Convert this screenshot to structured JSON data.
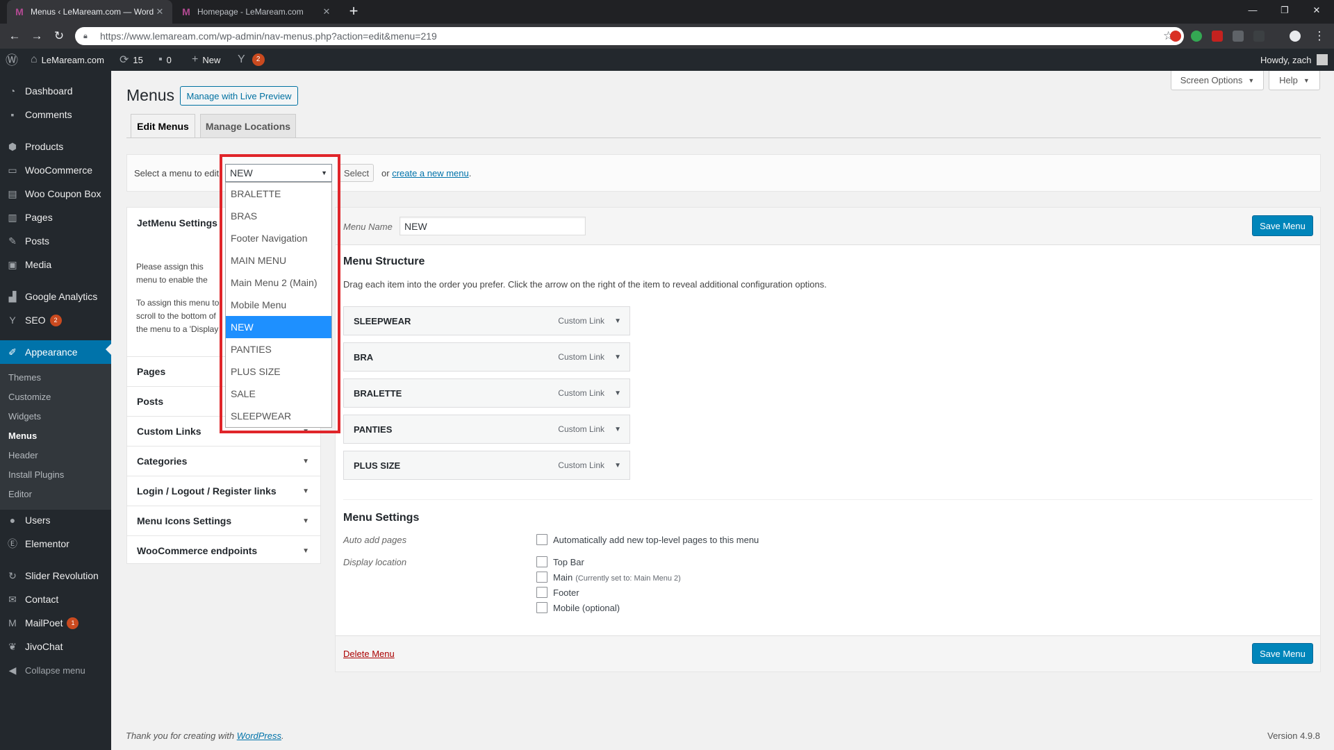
{
  "browser": {
    "tabs": [
      {
        "title": "Menus ‹ LeMaream.com — Word",
        "active": true
      },
      {
        "title": "Homepage - LeMaream.com",
        "active": false
      }
    ],
    "url": "https://www.lemaream.com/wp-admin/nav-menus.php?action=edit&menu=219"
  },
  "adminbar": {
    "site_name": "LeMaream.com",
    "updates": "15",
    "comments": "0",
    "new_label": "New",
    "seo_badge": "2",
    "howdy": "Howdy, zach"
  },
  "sidebar": {
    "items": [
      {
        "label": "Dashboard",
        "icon": "dashboard-icon"
      },
      {
        "label": "Comments",
        "icon": "comment-icon"
      },
      {
        "label": "Products",
        "icon": "products-icon"
      },
      {
        "label": "WooCommerce",
        "icon": "woocommerce-icon"
      },
      {
        "label": "Woo Coupon Box",
        "icon": "coupon-icon"
      },
      {
        "label": "Pages",
        "icon": "pages-icon"
      },
      {
        "label": "Posts",
        "icon": "pin-icon"
      },
      {
        "label": "Media",
        "icon": "media-icon"
      },
      {
        "label": "Google Analytics",
        "icon": "analytics-icon"
      },
      {
        "label": "SEO",
        "icon": "yoast-icon",
        "badge": "2"
      },
      {
        "label": "Appearance",
        "icon": "brush-icon",
        "active": true
      },
      {
        "label": "Users",
        "icon": "users-icon"
      },
      {
        "label": "Elementor",
        "icon": "elementor-icon"
      },
      {
        "label": "Slider Revolution",
        "icon": "refresh-icon"
      },
      {
        "label": "Contact",
        "icon": "mail-icon"
      },
      {
        "label": "MailPoet",
        "icon": "mailpoet-icon",
        "badge": "1"
      },
      {
        "label": "JivoChat",
        "icon": "leaf-icon"
      },
      {
        "label": "Collapse menu",
        "icon": "collapse-icon"
      }
    ],
    "submenu": [
      "Themes",
      "Customize",
      "Widgets",
      "Menus",
      "Header",
      "Install Plugins",
      "Editor"
    ]
  },
  "page": {
    "title": "Menus",
    "live_preview": "Manage with Live Preview",
    "screen_options": "Screen Options",
    "help": "Help",
    "tabs": [
      "Edit Menus",
      "Manage Locations"
    ],
    "select_label": "Select a menu to edit:",
    "selected_menu": "NEW",
    "select_button": "Select",
    "or_text": "or",
    "create_link": "create a new menu",
    "period": "."
  },
  "dropdown": {
    "options": [
      "BRALETTE",
      "BRAS",
      "Footer Navigation",
      "MAIN MENU",
      "Main Menu 2 (Main)",
      "Mobile Menu",
      "NEW",
      "PANTIES",
      "PLUS SIZE",
      "SALE",
      "SLEEPWEAR"
    ],
    "selected_index": 6
  },
  "left_panel": {
    "jetmenu_title": "JetMenu Settings",
    "jetmenu_text1": "Please assign this menu to enable the JetMenu",
    "jetmenu_text2": "To assign this menu to scroll to the bottom of the menu to a 'Display",
    "sections": [
      "Pages",
      "Posts",
      "Custom Links",
      "Categories",
      "Login / Logout / Register links",
      "Menu Icons Settings",
      "WooCommerce endpoints"
    ]
  },
  "editor": {
    "menu_name_label": "Menu Name",
    "menu_name_value": "NEW",
    "save_label": "Save Menu",
    "structure_title": "Menu Structure",
    "structure_desc": "Drag each item into the order you prefer. Click the arrow on the right of the item to reveal additional configuration options.",
    "items": [
      {
        "title": "SLEEPWEAR",
        "type": "Custom Link"
      },
      {
        "title": "BRA",
        "type": "Custom Link"
      },
      {
        "title": "BRALETTE",
        "type": "Custom Link"
      },
      {
        "title": "PANTIES",
        "type": "Custom Link"
      },
      {
        "title": "PLUS SIZE",
        "type": "Custom Link"
      }
    ],
    "settings_title": "Menu Settings",
    "auto_add_label": "Auto add pages",
    "auto_add_option": "Automatically add new top-level pages to this menu",
    "display_location_label": "Display location",
    "locations": [
      {
        "label": "Top Bar",
        "note": ""
      },
      {
        "label": "Main",
        "note": "(Currently set to: Main Menu 2)"
      },
      {
        "label": "Footer",
        "note": ""
      },
      {
        "label": "Mobile (optional)",
        "note": ""
      }
    ],
    "delete_label": "Delete Menu"
  },
  "footer": {
    "thanks_prefix": "Thank you for creating with",
    "thanks_link": "WordPress",
    "thanks_suffix": ".",
    "version": "Version 4.9.8"
  },
  "colors": {
    "accent": "#0073aa",
    "primary_button": "#0085ba",
    "highlight_border": "#e0252a",
    "selected_option": "#1e90ff"
  }
}
